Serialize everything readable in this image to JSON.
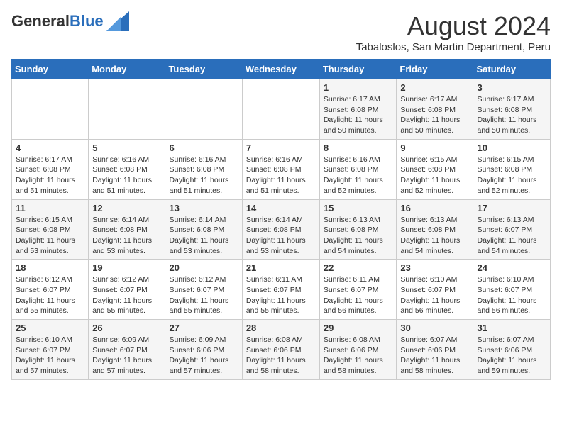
{
  "header": {
    "logo_general": "General",
    "logo_blue": "Blue",
    "title": "August 2024",
    "location": "Tabaloslos, San Martin Department, Peru"
  },
  "days_of_week": [
    "Sunday",
    "Monday",
    "Tuesday",
    "Wednesday",
    "Thursday",
    "Friday",
    "Saturday"
  ],
  "weeks": [
    [
      {
        "day": "",
        "info": ""
      },
      {
        "day": "",
        "info": ""
      },
      {
        "day": "",
        "info": ""
      },
      {
        "day": "",
        "info": ""
      },
      {
        "day": "1",
        "info": "Sunrise: 6:17 AM\nSunset: 6:08 PM\nDaylight: 11 hours and 50 minutes."
      },
      {
        "day": "2",
        "info": "Sunrise: 6:17 AM\nSunset: 6:08 PM\nDaylight: 11 hours and 50 minutes."
      },
      {
        "day": "3",
        "info": "Sunrise: 6:17 AM\nSunset: 6:08 PM\nDaylight: 11 hours and 50 minutes."
      }
    ],
    [
      {
        "day": "4",
        "info": "Sunrise: 6:17 AM\nSunset: 6:08 PM\nDaylight: 11 hours and 51 minutes."
      },
      {
        "day": "5",
        "info": "Sunrise: 6:16 AM\nSunset: 6:08 PM\nDaylight: 11 hours and 51 minutes."
      },
      {
        "day": "6",
        "info": "Sunrise: 6:16 AM\nSunset: 6:08 PM\nDaylight: 11 hours and 51 minutes."
      },
      {
        "day": "7",
        "info": "Sunrise: 6:16 AM\nSunset: 6:08 PM\nDaylight: 11 hours and 51 minutes."
      },
      {
        "day": "8",
        "info": "Sunrise: 6:16 AM\nSunset: 6:08 PM\nDaylight: 11 hours and 52 minutes."
      },
      {
        "day": "9",
        "info": "Sunrise: 6:15 AM\nSunset: 6:08 PM\nDaylight: 11 hours and 52 minutes."
      },
      {
        "day": "10",
        "info": "Sunrise: 6:15 AM\nSunset: 6:08 PM\nDaylight: 11 hours and 52 minutes."
      }
    ],
    [
      {
        "day": "11",
        "info": "Sunrise: 6:15 AM\nSunset: 6:08 PM\nDaylight: 11 hours and 53 minutes."
      },
      {
        "day": "12",
        "info": "Sunrise: 6:14 AM\nSunset: 6:08 PM\nDaylight: 11 hours and 53 minutes."
      },
      {
        "day": "13",
        "info": "Sunrise: 6:14 AM\nSunset: 6:08 PM\nDaylight: 11 hours and 53 minutes."
      },
      {
        "day": "14",
        "info": "Sunrise: 6:14 AM\nSunset: 6:08 PM\nDaylight: 11 hours and 53 minutes."
      },
      {
        "day": "15",
        "info": "Sunrise: 6:13 AM\nSunset: 6:08 PM\nDaylight: 11 hours and 54 minutes."
      },
      {
        "day": "16",
        "info": "Sunrise: 6:13 AM\nSunset: 6:08 PM\nDaylight: 11 hours and 54 minutes."
      },
      {
        "day": "17",
        "info": "Sunrise: 6:13 AM\nSunset: 6:07 PM\nDaylight: 11 hours and 54 minutes."
      }
    ],
    [
      {
        "day": "18",
        "info": "Sunrise: 6:12 AM\nSunset: 6:07 PM\nDaylight: 11 hours and 55 minutes."
      },
      {
        "day": "19",
        "info": "Sunrise: 6:12 AM\nSunset: 6:07 PM\nDaylight: 11 hours and 55 minutes."
      },
      {
        "day": "20",
        "info": "Sunrise: 6:12 AM\nSunset: 6:07 PM\nDaylight: 11 hours and 55 minutes."
      },
      {
        "day": "21",
        "info": "Sunrise: 6:11 AM\nSunset: 6:07 PM\nDaylight: 11 hours and 55 minutes."
      },
      {
        "day": "22",
        "info": "Sunrise: 6:11 AM\nSunset: 6:07 PM\nDaylight: 11 hours and 56 minutes."
      },
      {
        "day": "23",
        "info": "Sunrise: 6:10 AM\nSunset: 6:07 PM\nDaylight: 11 hours and 56 minutes."
      },
      {
        "day": "24",
        "info": "Sunrise: 6:10 AM\nSunset: 6:07 PM\nDaylight: 11 hours and 56 minutes."
      }
    ],
    [
      {
        "day": "25",
        "info": "Sunrise: 6:10 AM\nSunset: 6:07 PM\nDaylight: 11 hours and 57 minutes."
      },
      {
        "day": "26",
        "info": "Sunrise: 6:09 AM\nSunset: 6:07 PM\nDaylight: 11 hours and 57 minutes."
      },
      {
        "day": "27",
        "info": "Sunrise: 6:09 AM\nSunset: 6:06 PM\nDaylight: 11 hours and 57 minutes."
      },
      {
        "day": "28",
        "info": "Sunrise: 6:08 AM\nSunset: 6:06 PM\nDaylight: 11 hours and 58 minutes."
      },
      {
        "day": "29",
        "info": "Sunrise: 6:08 AM\nSunset: 6:06 PM\nDaylight: 11 hours and 58 minutes."
      },
      {
        "day": "30",
        "info": "Sunrise: 6:07 AM\nSunset: 6:06 PM\nDaylight: 11 hours and 58 minutes."
      },
      {
        "day": "31",
        "info": "Sunrise: 6:07 AM\nSunset: 6:06 PM\nDaylight: 11 hours and 59 minutes."
      }
    ]
  ]
}
